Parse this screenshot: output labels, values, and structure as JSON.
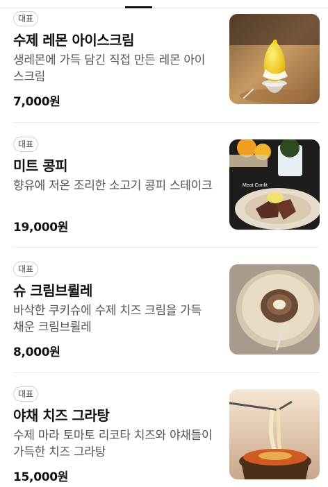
{
  "menu": {
    "items": [
      {
        "badge": "대표",
        "name": "수제 레몬 아이스크림",
        "description": "생레몬에 가득 담긴 직접 만든 레몬 아이스크림",
        "price": "7,000원",
        "image_icon": "lemon-ice-cream-photo"
      },
      {
        "badge": "대표",
        "name": "미트 콩피",
        "description": "향유에 저온 조리한 소고기 콩피 스테이크",
        "price": "19,000원",
        "image_icon": "meat-confit-photo",
        "image_caption": "Meat Confit"
      },
      {
        "badge": "대표",
        "name": "슈 크림브륄레",
        "description": "바삭한 쿠키슈에 수제 치즈 크림을 가득 채운 크림브륄레",
        "price": "8,000원",
        "image_icon": "choux-creme-brulee-photo"
      },
      {
        "badge": "대표",
        "name": "야채 치즈 그라탕",
        "description": "수제 마라 토마토 리코타 치즈와 야채들이 가득한 치즈 그라탕",
        "price": "15,000원",
        "image_icon": "vegetable-cheese-gratin-photo"
      }
    ]
  }
}
